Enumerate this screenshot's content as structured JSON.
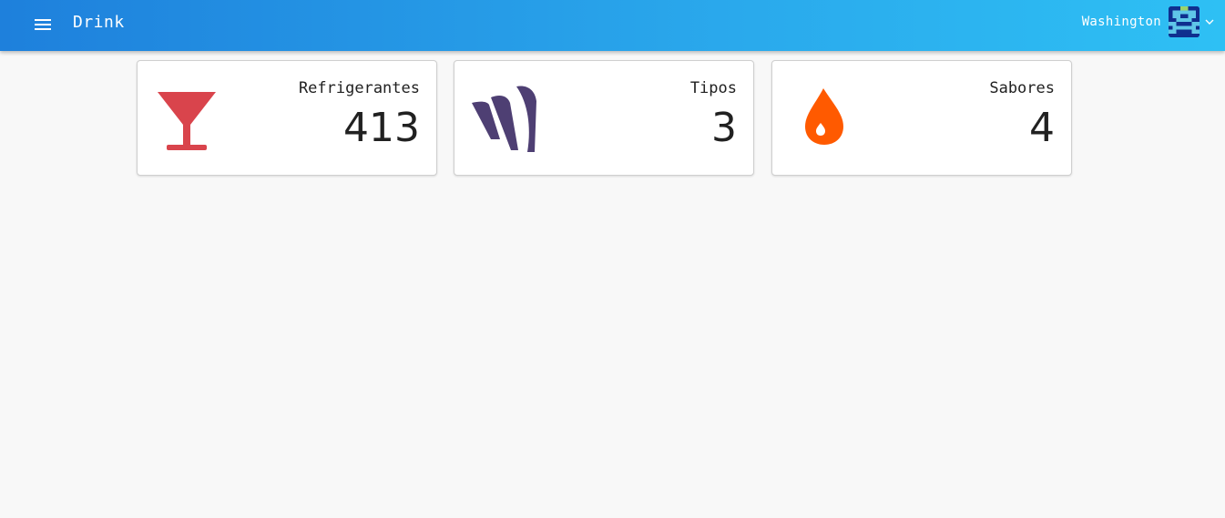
{
  "header": {
    "title": "Drink",
    "menu_icon": "menu-icon",
    "user_name": "Washington",
    "avatar_icon": "pixel-avatar-icon",
    "dropdown_icon": "chevron-down-icon"
  },
  "cards": [
    {
      "label": "Refrigerantes",
      "value": "413",
      "icon": "cocktail-glass-icon",
      "color": "#d9444c"
    },
    {
      "label": "Tipos",
      "value": "3",
      "icon": "wave-logo-icon",
      "color": "#4e3f73"
    },
    {
      "label": "Sabores",
      "value": "4",
      "icon": "drop-icon",
      "color": "#ff5a00"
    }
  ],
  "colors": {
    "appbar_start": "#1e80dc",
    "appbar_end": "#2ec0f4",
    "background": "#f8f8f8"
  }
}
